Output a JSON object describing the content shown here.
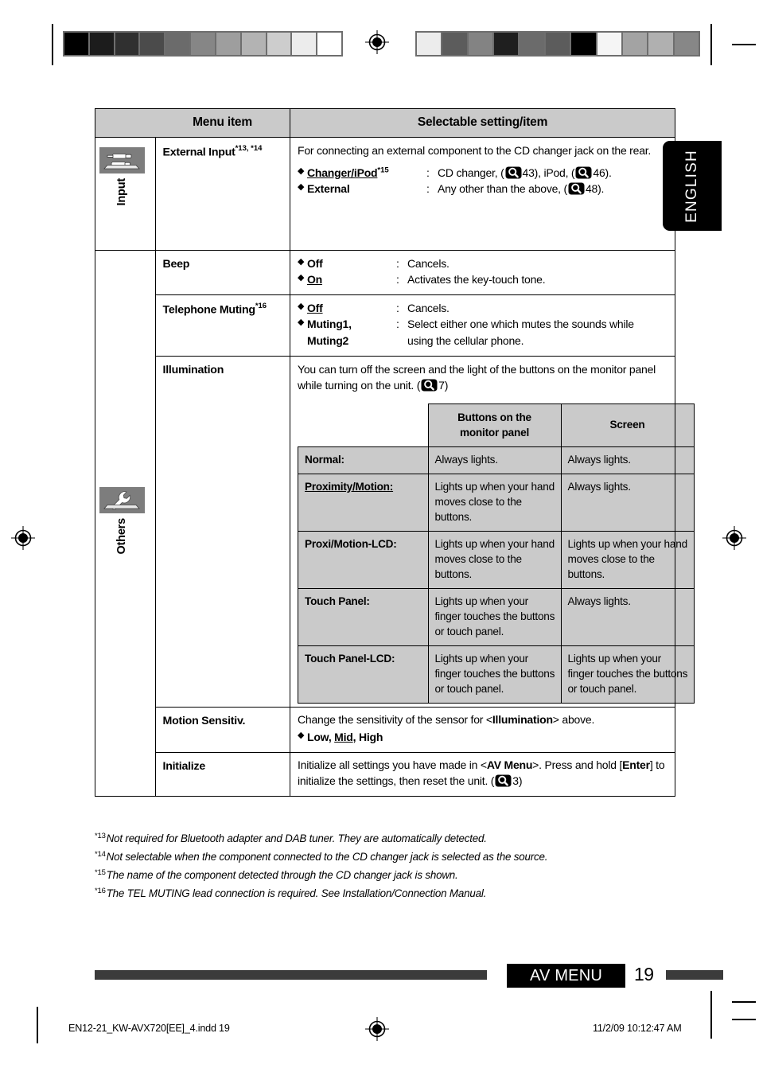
{
  "page": {
    "language_tab": "ENGLISH",
    "footer_section": "AV MENU",
    "page_number": "19",
    "imprint_file": "EN12-21_KW-AVX720[EE]_4.indd   19",
    "imprint_date": "11/2/09   10:12:47 AM"
  },
  "table": {
    "headers": {
      "menu_item": "Menu item",
      "selectable": "Selectable setting/item"
    },
    "groups": [
      {
        "label": "Input",
        "icon": "external-input-icon"
      },
      {
        "label": "Others",
        "icon": "wrench-icon"
      }
    ],
    "rows": {
      "external_input": {
        "name": "External Input",
        "footnotes": "*13, *14",
        "intro": "For connecting an external component to the CD changer jack on the rear.",
        "options": [
          {
            "name": "Changer/iPod",
            "footnote": "*15",
            "colon": ":",
            "value_pre": "CD changer, (",
            "value_ref1": "43",
            "value_mid": "), iPod, (",
            "value_ref2": "46",
            "value_post": ")."
          },
          {
            "name": "External",
            "footnote": "",
            "colon": ":",
            "value_pre": "Any other than the above, (",
            "value_ref1": "48",
            "value_mid": "",
            "value_ref2": "",
            "value_post": ")."
          }
        ]
      },
      "beep": {
        "name": "Beep",
        "footnotes": "",
        "options": [
          {
            "name": "Off",
            "underline": false,
            "colon": ":",
            "value": "Cancels."
          },
          {
            "name": "On",
            "underline": true,
            "colon": ":",
            "value": "Activates the key-touch tone."
          }
        ]
      },
      "telephone_muting": {
        "name": "Telephone Muting",
        "footnotes": "*16",
        "options": [
          {
            "name": "Off",
            "underline": true,
            "colon": ":",
            "value": "Cancels."
          },
          {
            "name": "Muting1,",
            "name2": "Muting2",
            "underline": false,
            "colon": ":",
            "value": "Select either one which mutes the sounds while",
            "value2": "using the cellular phone."
          }
        ]
      },
      "illumination": {
        "name": "Illumination",
        "desc_pre": "You can turn off the screen and the light of the buttons on the monitor panel while turning on the unit. (",
        "desc_ref": "7",
        "desc_post": ")",
        "subtable": {
          "headers": [
            "",
            "Buttons on the monitor panel",
            "Screen"
          ],
          "header_col2_line1": "Buttons on the",
          "header_col2_line2": "monitor panel",
          "header_col3": "Screen",
          "rows": [
            {
              "label": "Normal:",
              "underline": false,
              "buttons": "Always lights.",
              "screen": "Always lights."
            },
            {
              "label": "Proximity/Motion:",
              "underline": true,
              "buttons": "Lights up when your hand moves close to the buttons.",
              "screen": "Always lights."
            },
            {
              "label": "Proxi/Motion-LCD:",
              "underline": false,
              "buttons": "Lights up when your hand moves close to the buttons.",
              "screen": "Lights up when your hand moves close to the buttons."
            },
            {
              "label": "Touch Panel:",
              "underline": false,
              "buttons": "Lights up when your finger touches the buttons or touch panel.",
              "screen": "Always lights."
            },
            {
              "label": "Touch Panel-LCD:",
              "underline": false,
              "buttons": "Lights up when your finger touches the buttons or touch panel.",
              "screen": "Lights up when your finger touches the buttons or touch panel."
            }
          ]
        }
      },
      "motion_sensitiv": {
        "name": "Motion Sensitiv.",
        "desc_pre": "Change the sensitivity of the sensor for <",
        "desc_bold": "Illumination",
        "desc_post": "> above.",
        "option_pre": "Low, ",
        "option_mid": "Mid",
        "option_post": ", High"
      },
      "initialize": {
        "name": "Initialize",
        "desc_pre": "Initialize all settings you have made in <",
        "desc_bold1": "AV Menu",
        "desc_mid": ">. Press and hold [",
        "desc_bold2": "Enter",
        "desc_mid2": "] to initialize the settings, then reset the unit. (",
        "desc_ref": "3",
        "desc_post": ")"
      }
    }
  },
  "footnotes": [
    {
      "marker": "*13",
      "text": "Not required for Bluetooth adapter and DAB tuner. They are automatically detected."
    },
    {
      "marker": "*14",
      "text": "Not selectable when the component connected to the CD changer jack is selected as the source."
    },
    {
      "marker": "*15",
      "text": "The name of the component detected through the CD changer jack is shown."
    },
    {
      "marker": "*16",
      "text": "The TEL MUTING lead connection is required. See Installation/Connection Manual."
    }
  ],
  "calibration": {
    "left_bar": [
      "#000000",
      "#1c1c1c",
      "#303030",
      "#4b4b4b",
      "#6b6b6b",
      "#868686",
      "#9e9e9e",
      "#b3b3b3",
      "#cdcdcd",
      "#ececec",
      "#ffffff"
    ],
    "right_bar": [
      "#ececec",
      "#5c5c5c",
      "#838383",
      "#1f1f1f",
      "#6b6b6b",
      "#5c5c5c",
      "#000000",
      "#f5f5f5",
      "#a3a3a3",
      "#b0b0b0",
      "#878787"
    ]
  },
  "colors": {
    "header_gray": "#cacaca",
    "bar_dark": "#3b3b3b",
    "icon_tab": "#7a7a7a"
  }
}
